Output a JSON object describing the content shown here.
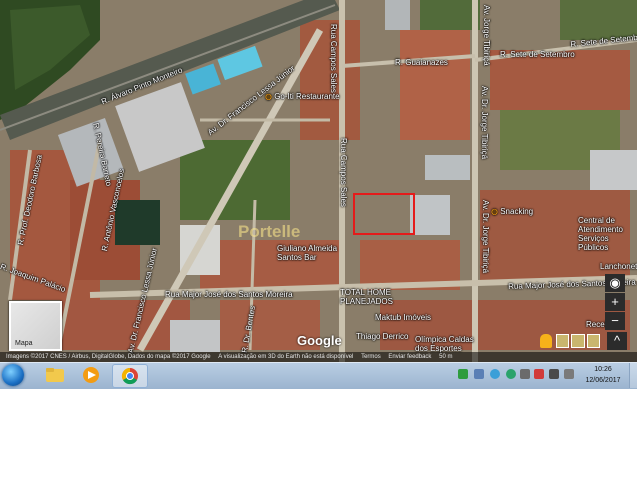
{
  "map": {
    "streets": {
      "alvaro_pinto": "R. Álvaro Pinto Monteiro",
      "francisco_lessa": "Av. Dr. Francisco Lessa Júnior",
      "francisco_lessa_lower": "Av. Dr. Francisco Lessa Júnior",
      "pereira_barreto": "R. Pereira Barreto",
      "deodoro": "R. Prof. Deodoro Barbosa",
      "antonio_vasconcelos": "R. Antônio Vasconcelos",
      "joaquim_palacio": "R. Joaquim Palácio",
      "campos_sales_top": "Rua Campos Sales",
      "campos_sales_mid": "Rua Campos Sales",
      "guaianazes": "R. Guaianazes",
      "jorge_tibirica_top": "Av. Jorge Tibiriçá",
      "jorge_tibirica_mid": "Av. Dr. Jorge Tibiriçá",
      "jorge_tibirica_low": "Av. Dr. Jorge Tibiriçá",
      "sete_setembro_a": "R. Sete de Setembro",
      "sete_setembro_b": "R. Sete de Setembro",
      "major_jose_left": "Rua Major José dos Santos Moreira",
      "major_jose_right": "Rua Major José dos Santos Moreira",
      "dr_bentes": "R. Dr. Bentes"
    },
    "pois": {
      "goiti": "Go-Iti Restaurante",
      "giuliano": "Giuliano Almeida Santos Bar",
      "snacking": "Snacking",
      "central": "Central de Atendimento Serviços Públicos",
      "lanchonete": "Lanchonete",
      "total_home": "TOTAL HOME PLANEJADOS",
      "maktub": "Maktub Imóveis",
      "thiago": "Thiago Derrico",
      "olimpica": "Olímpica Caldas dos Esportes",
      "receita": "Receita"
    },
    "watermark": "Portelle",
    "google_logo": "Google",
    "thumbnail_label": "Mapa",
    "attribution": {
      "imagery": "Imagens ©2017 CNES / Airbus, DigitalGlobe, Dados do mapa ©2017 Google",
      "earth": "A visualização em 3D do Earth não está disponível",
      "terms": "Termos",
      "feedback": "Enviar feedback",
      "scale": "50 m"
    },
    "controls": {
      "zoom_in": "+",
      "zoom_out": "−",
      "expand": "^"
    }
  },
  "taskbar": {
    "time": "10:26",
    "date": "12/06/2017",
    "apps": [
      "windows-explorer",
      "media-player",
      "google-chrome"
    ]
  },
  "colors": {
    "selection": "#e51b1b",
    "taskbar": "#b9cde3",
    "map_base": "#7a6f5e"
  }
}
